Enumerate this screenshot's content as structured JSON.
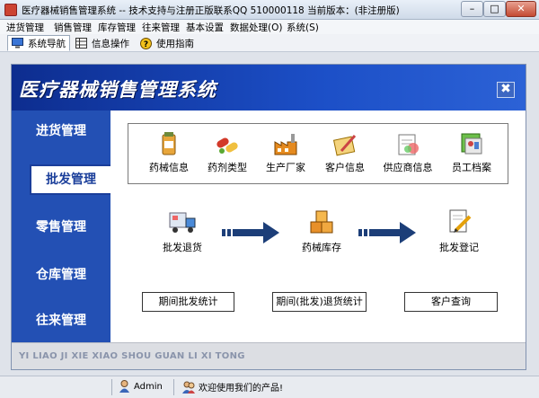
{
  "window": {
    "title": "医疗器械销售管理系统 -- 技术支持与注册正版联系QQ 510000118   当前版本：(非注册版)",
    "controls": [
      "minimize",
      "maximize",
      "close"
    ]
  },
  "menu": [
    "进货管理",
    "销售管理",
    "库存管理",
    "往来管理",
    "基本设置",
    "数据处理(O)",
    "系统(S)"
  ],
  "toolbar": {
    "nav": "系统导航",
    "info": "信息操作",
    "guide": "使用指南"
  },
  "banner": {
    "title": "医疗器械销售管理系统"
  },
  "sidebar": [
    "进货管理",
    "批发管理",
    "零售管理",
    "仓库管理",
    "往来管理"
  ],
  "modules": [
    "药械信息",
    "药剂类型",
    "生产厂家",
    "客户信息",
    "供应商信息",
    "员工档案"
  ],
  "flow": [
    "批发退货",
    "药械库存",
    "批发登记"
  ],
  "actions": [
    "期间批发统计",
    "期间(批发)退货统计",
    "客户查询"
  ],
  "footer": {
    "pinyin": "YI LIAO JI XIE XIAO SHOU GUAN LI XI TONG"
  },
  "status": {
    "user": "Admin",
    "welcome": "欢迎使用我们的产品!"
  },
  "colors": {
    "brand": "#1c4fc7",
    "sidebar": "#2350b4",
    "footer": "#dcdee3"
  }
}
